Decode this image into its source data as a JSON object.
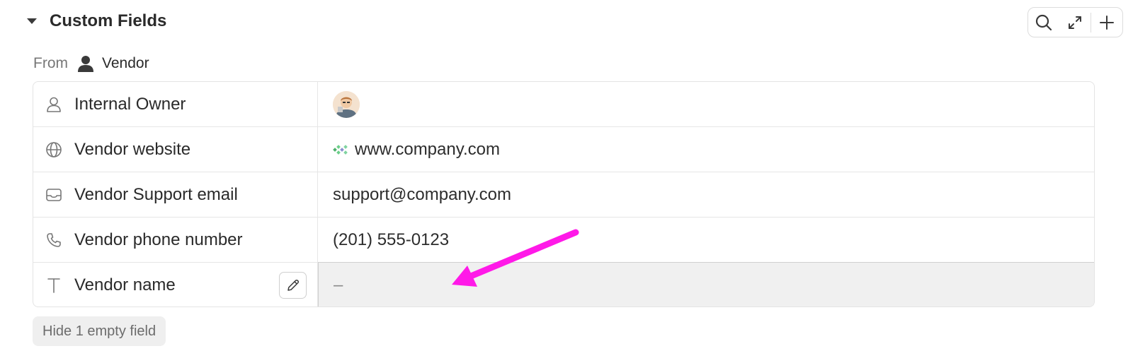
{
  "section": {
    "title": "Custom Fields",
    "toolbar": {
      "search_icon": "search-icon",
      "expand_icon": "expand-icon",
      "add_icon": "plus-icon"
    }
  },
  "source": {
    "from_label": "From",
    "entity_icon": "person-icon",
    "entity": "Vendor"
  },
  "fields": [
    {
      "label": "Internal Owner",
      "icon": "user-outline-icon",
      "value": "",
      "value_type": "avatar"
    },
    {
      "label": "Vendor website",
      "icon": "globe-icon",
      "value": "www.company.com",
      "value_type": "link"
    },
    {
      "label": "Vendor Support email",
      "icon": "mail-icon",
      "value": "support@company.com",
      "value_type": "text"
    },
    {
      "label": "Vendor phone number",
      "icon": "phone-icon",
      "value": "(201) 555-0123",
      "value_type": "text"
    },
    {
      "label": "Vendor name",
      "icon": "text-type-icon",
      "value": "–",
      "value_type": "empty",
      "edit_icon": "pencil-icon"
    }
  ],
  "footer": {
    "hide_empty_label": "Hide 1 empty field"
  },
  "colors": {
    "annotation_arrow": "#ff19e8",
    "empty_cell_bg": "#f0f0f0",
    "border": "#e4e4e4"
  }
}
